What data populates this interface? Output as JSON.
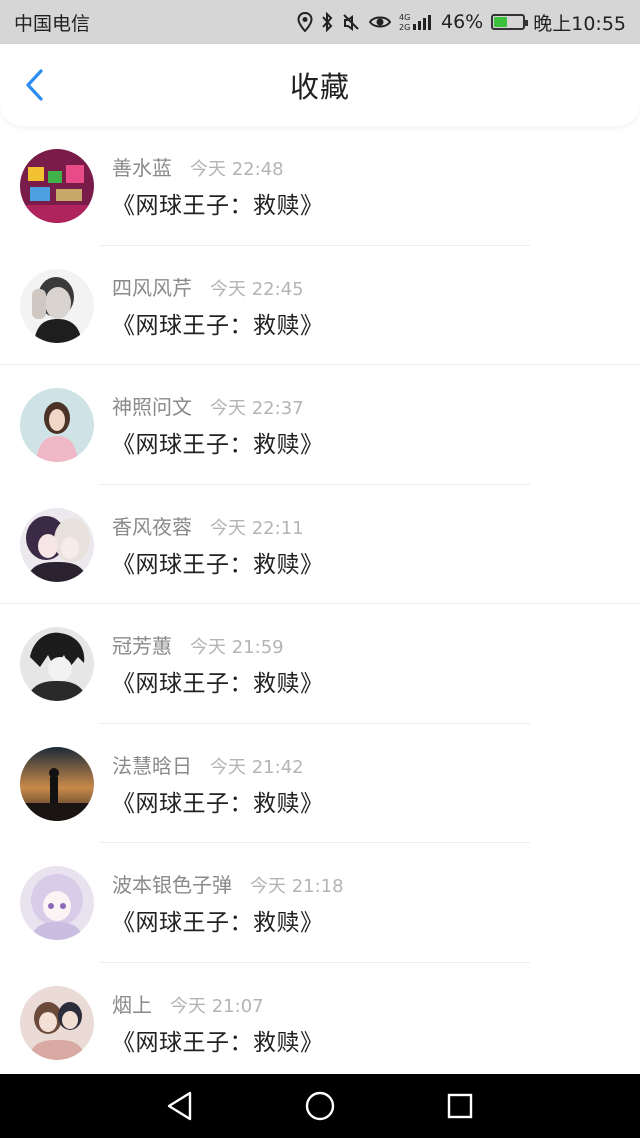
{
  "status_bar": {
    "carrier": "中国电信",
    "network": "4G 2G",
    "battery_percent": "46%",
    "battery_level": 0.46,
    "time": "晚上10:55",
    "icons": [
      "location-icon",
      "bluetooth-icon",
      "mute-icon",
      "eye-icon",
      "signal-icon",
      "battery-icon"
    ]
  },
  "header": {
    "title": "收藏",
    "back_icon": "chevron-left-icon",
    "accent_color": "#2b8cf2"
  },
  "list": {
    "items": [
      {
        "username": "善水蓝",
        "time": "今天 22:48",
        "title": "《网球王子：救赎》"
      },
      {
        "username": "四风风芹",
        "time": "今天 22:45",
        "title": "《网球王子：救赎》"
      },
      {
        "username": "神照问文",
        "time": "今天 22:37",
        "title": "《网球王子：救赎》"
      },
      {
        "username": "香风夜蓉",
        "time": "今天 22:11",
        "title": "《网球王子：救赎》"
      },
      {
        "username": "冠芳蕙",
        "time": "今天 21:59",
        "title": "《网球王子：救赎》"
      },
      {
        "username": "法慧晗日",
        "time": "今天 21:42",
        "title": "《网球王子：救赎》"
      },
      {
        "username": "波本银色子弹",
        "time": "今天 21:18",
        "title": "《网球王子：救赎》"
      },
      {
        "username": "烟上",
        "time": "今天 21:07",
        "title": "《网球王子：救赎》"
      }
    ]
  },
  "nav_bar": {
    "icons": [
      "back-triangle-icon",
      "home-circle-icon",
      "recents-square-icon"
    ]
  }
}
